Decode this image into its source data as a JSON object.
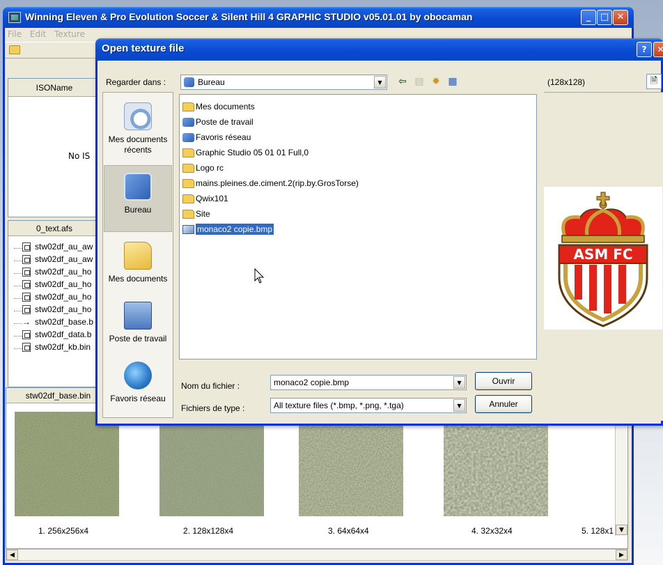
{
  "app": {
    "title": "Winning Eleven & Pro Evolution Soccer & Silent Hill 4 GRAPHIC STUDIO v05.01.01 by obocaman",
    "menu": [
      "File",
      "Edit",
      "Texture"
    ],
    "iso_header": "ISOName",
    "iso_empty": "No IS",
    "afs_header": "0_text.afs",
    "afs_files": [
      "stw02df_au_aw",
      "stw02df_au_aw",
      "stw02df_au_ho",
      "stw02df_au_ho",
      "stw02df_au_ho",
      "stw02df_au_ho",
      "stw02df_base.b",
      "stw02df_data.b",
      "stw02df_kb.bin"
    ],
    "bin_header": "stw02df_base.bin",
    "textures": [
      "1. 256x256x4",
      "2. 128x128x4",
      "3. 64x64x4",
      "4. 32x32x4",
      "5. 128x1"
    ]
  },
  "dialog": {
    "title": "Open texture file",
    "lookin_label": "Regarder dans :",
    "lookin_value": "Bureau",
    "places": [
      {
        "label": "Mes documents récents",
        "icon": "recent-documents-icon"
      },
      {
        "label": "Bureau",
        "icon": "desktop-icon"
      },
      {
        "label": "Mes documents",
        "icon": "my-documents-icon"
      },
      {
        "label": "Poste de travail",
        "icon": "my-computer-icon"
      },
      {
        "label": "Favoris réseau",
        "icon": "network-places-icon"
      }
    ],
    "files": [
      {
        "name": "Mes documents",
        "type": "folder"
      },
      {
        "name": "Poste de travail",
        "type": "special"
      },
      {
        "name": "Favoris réseau",
        "type": "special"
      },
      {
        "name": "Graphic Studio 05 01 01 Full,0",
        "type": "folder"
      },
      {
        "name": "Logo rc",
        "type": "folder"
      },
      {
        "name": "mains.pleines.de.ciment.2(rip.by.GrosTorse)",
        "type": "folder"
      },
      {
        "name": "Qwix101",
        "type": "folder"
      },
      {
        "name": "Site",
        "type": "folder"
      },
      {
        "name": "monaco2 copie.bmp",
        "type": "bmp",
        "selected": true
      }
    ],
    "filename_label": "Nom du fichier :",
    "filename_value": "monaco2 copie.bmp",
    "filetype_label": "Fichiers de type :",
    "filetype_value": "All texture files (*.bmp, *.png, *.tga)",
    "open_button": "Ouvrir",
    "cancel_button": "Annuler",
    "preview_size": "(128x128)",
    "logo_text": "ASM FC",
    "colors": {
      "logo_red": "#e2231a",
      "crown_gold": "#c8a13a",
      "selection": "#316ac5",
      "titlebar": "#0a4bd4"
    }
  }
}
